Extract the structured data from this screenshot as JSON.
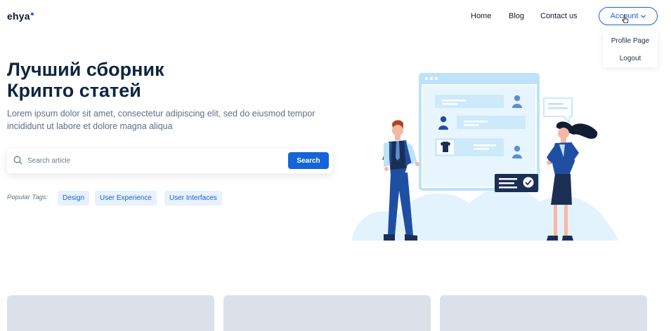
{
  "header": {
    "logo": "ehya",
    "nav": [
      "Home",
      "Blog",
      "Contact us"
    ],
    "account_label": "Account",
    "account_menu": [
      "Profile Page",
      "Logout"
    ]
  },
  "hero": {
    "title_line1": "Лучший сборник",
    "title_line2": "Крипто статей",
    "subtitle": "Lorem ipsum dolor sit amet, consectetur adipiscing elit, sed do eiusmod tempor incididunt ut labore et dolore magna aliqua",
    "search_placeholder": "Search article",
    "search_button": "Search",
    "popular_label": "Popular Tags:",
    "tags": [
      "Design",
      "User Experience",
      "User Interfaces"
    ]
  },
  "icons": {
    "search": "search-icon",
    "chevron": "chevron-down-icon",
    "cursor": "pointer-cursor-icon"
  },
  "colors": {
    "primary": "#1565d8",
    "heading": "#0d2540",
    "body_text": "#5a7184",
    "tag_bg": "#e8f1fd",
    "card_placeholder": "#dce1e9",
    "illustration_light": "#e3f3fd"
  }
}
